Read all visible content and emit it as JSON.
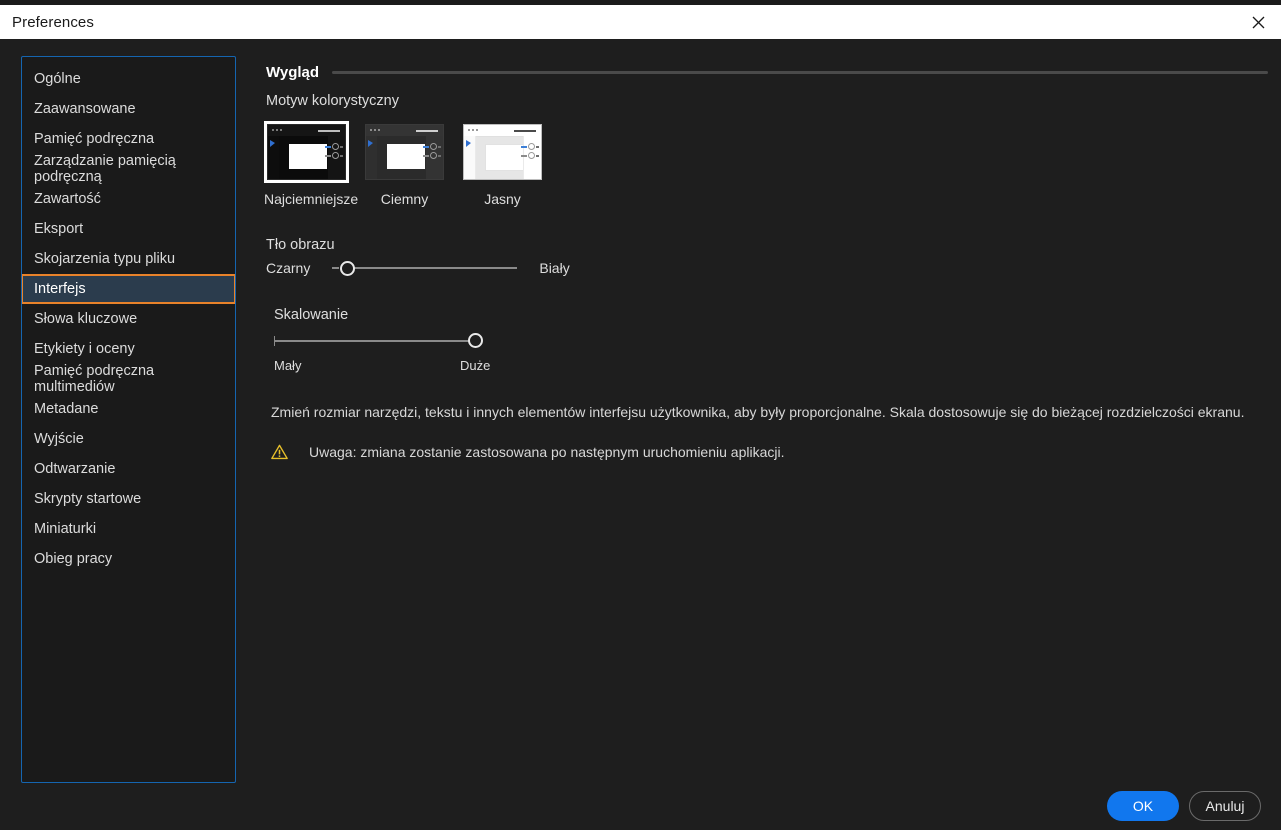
{
  "window": {
    "title": "Preferences",
    "close_icon": "close-icon"
  },
  "sidebar": {
    "items": [
      {
        "label": "Ogólne",
        "selected": false
      },
      {
        "label": "Zaawansowane",
        "selected": false
      },
      {
        "label": "Pamięć podręczna",
        "selected": false
      },
      {
        "label": "Zarządzanie pamięcią podręczną",
        "selected": false
      },
      {
        "label": "Zawartość",
        "selected": false
      },
      {
        "label": "Eksport",
        "selected": false
      },
      {
        "label": "Skojarzenia typu pliku",
        "selected": false
      },
      {
        "label": "Interfejs",
        "selected": true
      },
      {
        "label": "Słowa kluczowe",
        "selected": false
      },
      {
        "label": "Etykiety i oceny",
        "selected": false
      },
      {
        "label": "Pamięć podręczna multimediów",
        "selected": false
      },
      {
        "label": "Metadane",
        "selected": false
      },
      {
        "label": "Wyjście",
        "selected": false
      },
      {
        "label": "Odtwarzanie",
        "selected": false
      },
      {
        "label": "Skrypty startowe",
        "selected": false
      },
      {
        "label": "Miniaturki",
        "selected": false
      },
      {
        "label": "Obieg pracy",
        "selected": false
      }
    ]
  },
  "panel": {
    "section_title": "Wygląd",
    "theme": {
      "label": "Motyw kolorystyczny",
      "options": [
        {
          "name": "Najciemniejsze",
          "selected": true
        },
        {
          "name": "Ciemny",
          "selected": false
        },
        {
          "name": "Jasny",
          "selected": false
        }
      ]
    },
    "image_background": {
      "label": "Tło obrazu",
      "min_label": "Czarny",
      "max_label": "Biały",
      "value_percent": 4
    },
    "scaling": {
      "label": "Skalowanie",
      "min_label": "Mały",
      "max_label": "Duże",
      "value_percent": 100
    },
    "description": "Zmień rozmiar narzędzi, tekstu i innych elementów interfejsu użytkownika, aby były proporcjonalne. Skala dostosowuje się do bieżącej rozdzielczości ekranu.",
    "warning": {
      "icon": "warning-triangle-icon",
      "text": "Uwaga: zmiana zostanie zastosowana po następnym uruchomieniu aplikacji."
    }
  },
  "footer": {
    "ok_label": "OK",
    "cancel_label": "Anuluj"
  },
  "colors": {
    "accent_blue": "#1177ee",
    "focus_orange": "#e8822a",
    "selection_blue": "#2b3c4d",
    "list_border_blue": "#1565b0",
    "warning_amber": "#e8c02a",
    "background": "#1e1e1e",
    "titlebar": "#ffffff"
  }
}
